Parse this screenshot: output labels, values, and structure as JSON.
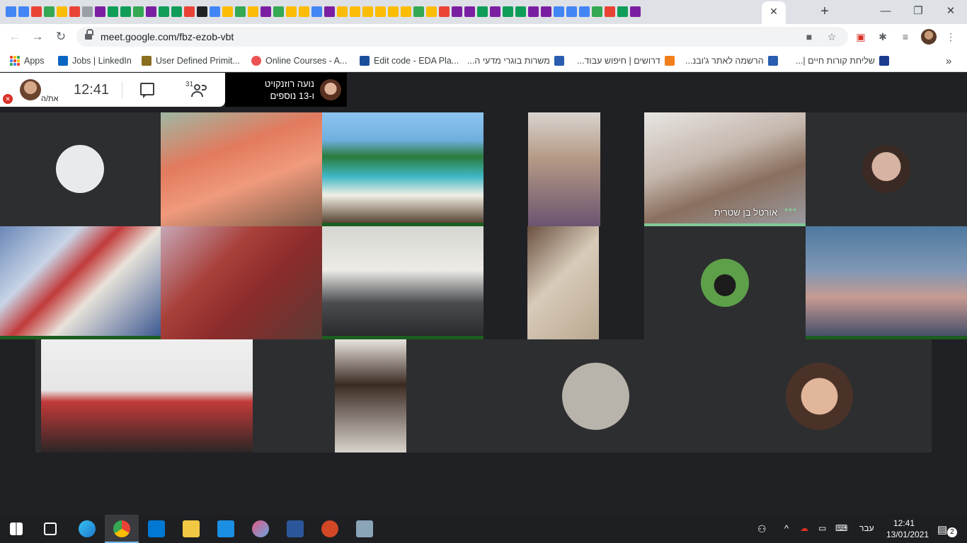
{
  "browser": {
    "url": "meet.google.com/fbz-ezob-vbt",
    "active_tab_close": "✕",
    "new_tab": "+",
    "window_controls": {
      "minimize": "—",
      "restore": "❐",
      "close": "✕"
    }
  },
  "bookmarks": [
    {
      "label": "Apps",
      "icon": "apps-grid-icon",
      "color": "#4285f4"
    },
    {
      "label": "Jobs | LinkedIn",
      "icon": "linkedin-icon",
      "color": "#0a66c2"
    },
    {
      "label": "User Defined Primit...",
      "icon": "book-icon",
      "color": "#8b6d1f"
    },
    {
      "label": "Online Courses - A...",
      "icon": "udemy-icon",
      "color": "#ec5252"
    },
    {
      "label": "Edit code - EDA Pla...",
      "icon": "eda-icon",
      "color": "#1b4f9c"
    },
    {
      "label": "משרות בוגרי מדעי ה...",
      "icon": "jobinfo-icon",
      "color": "#2a5db0"
    },
    {
      "label": "דרושים | חיפוש עבוד...",
      "icon": "t-icon",
      "color": "#f07f1b"
    },
    {
      "label": "הרשמה לאתר ג'ובנ...",
      "icon": "jobinfo-icon",
      "color": "#2a5db0"
    },
    {
      "label": "שליחת קורות חיים |...",
      "icon": "ji-icon",
      "color": "#1a3c8f"
    }
  ],
  "bookmarks_overflow": "»",
  "meet": {
    "clock": "12:41",
    "people_count": "31",
    "self_label": "את/ה",
    "presenter_name": "נועה רוזנקויט",
    "presenter_more": "ו-13 נוספים",
    "speaker_name": "אורטל בן שטרית"
  },
  "taskbar": {
    "language": "עבר",
    "time": "12:41",
    "date": "13/01/2021",
    "notifications": "2"
  }
}
